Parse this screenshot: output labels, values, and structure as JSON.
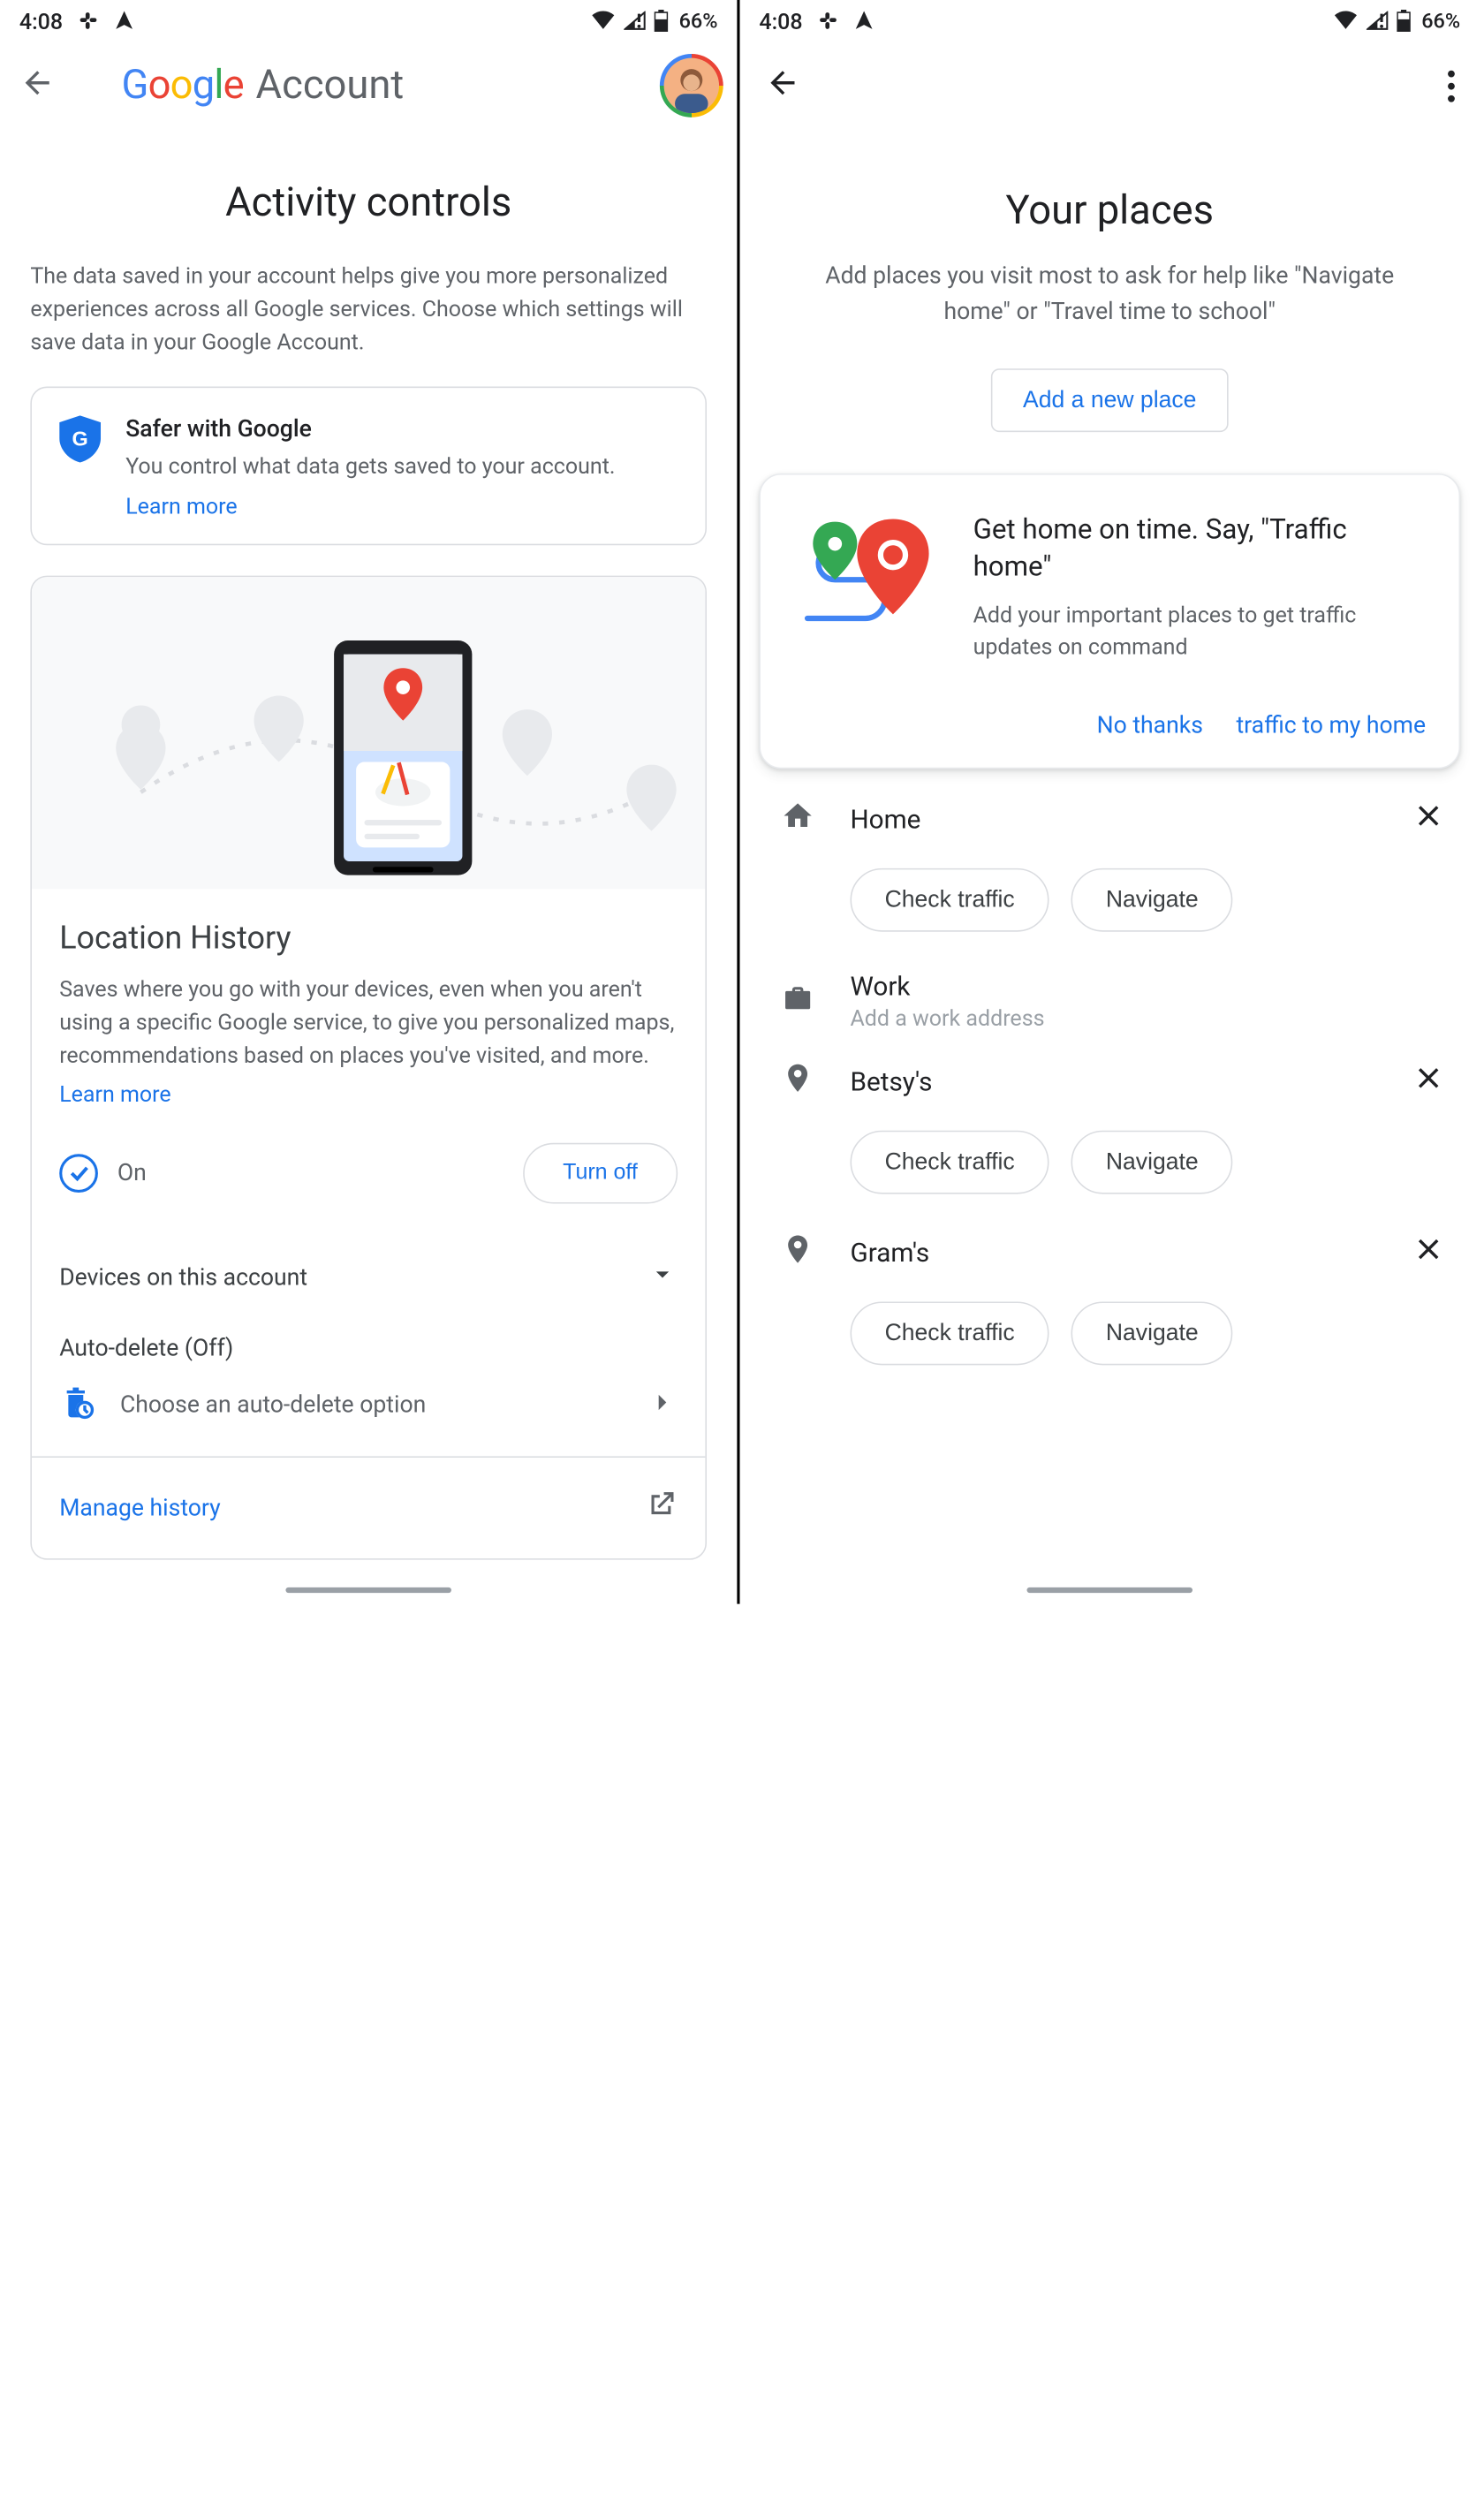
{
  "status": {
    "time": "4:08",
    "battery_pct": "66%"
  },
  "left": {
    "brand_word": "Account",
    "title": "Activity controls",
    "subtitle": "The data saved in your account helps give you more personalized experiences across all Google services. Choose which settings will save data in your Google Account.",
    "safer": {
      "title": "Safer with Google",
      "desc": "You control what data gets saved to your account.",
      "learn": "Learn more"
    },
    "loc": {
      "title": "Location History",
      "desc": "Saves where you go with your devices, even when you aren't using a specific Google service, to give you personalized maps, recommendations based on places you've visited, and more.",
      "learn": "Learn more",
      "state": "On",
      "turnoff": "Turn off",
      "devices": "Devices on this account",
      "autodel_title": "Auto-delete (Off)",
      "autodel_opt": "Choose an auto-delete option",
      "manage": "Manage history"
    }
  },
  "right": {
    "title": "Your places",
    "subtitle": "Add places you visit most to ask for help like \"Navigate home\" or \"Travel time to school\"",
    "add": "Add a new place",
    "tip": {
      "title": "Get home on time. Say, \"Traffic home\"",
      "desc": "Add your important places to get traffic updates on command",
      "no": "No thanks",
      "go": "traffic to my home"
    },
    "chip_traffic": "Check traffic",
    "chip_nav": "Navigate",
    "work_hint": "Add a work address",
    "places": {
      "home": {
        "label": "Home"
      },
      "work": {
        "label": "Work"
      },
      "betsy": {
        "label": "Betsy's"
      },
      "gram": {
        "label": "Gram's"
      }
    }
  }
}
